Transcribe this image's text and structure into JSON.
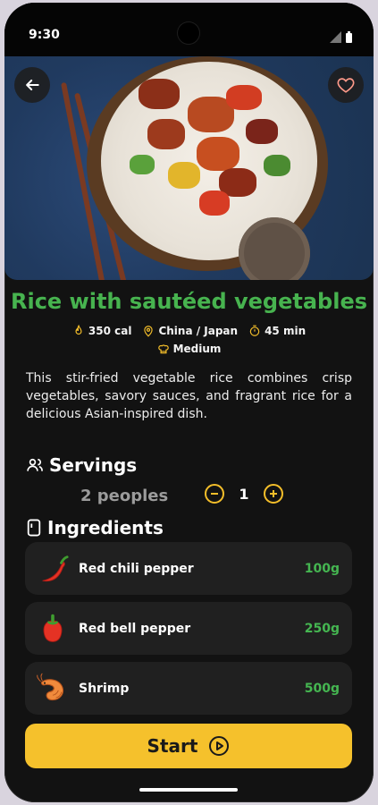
{
  "status": {
    "time": "9:30"
  },
  "recipe": {
    "title": "Rice with sautéed vegetables",
    "calories": "350 cal",
    "origin": "China / Japan",
    "duration": "45 min",
    "difficulty": "Medium",
    "description": "This stir-fried vegetable rice combines crisp vegetables, savory sauces, and fragrant rice for a delicious Asian-inspired dish."
  },
  "servings": {
    "title": "Servings",
    "label": "2 peoples",
    "value": "1"
  },
  "ingredients": {
    "title": "Ingredients",
    "items": [
      {
        "name": "Red chili pepper",
        "qty": "100g",
        "icon": "chili-pepper-icon"
      },
      {
        "name": "Red bell pepper",
        "qty": "250g",
        "icon": "bell-pepper-icon"
      },
      {
        "name": "Shrimp",
        "qty": "500g",
        "icon": "shrimp-icon"
      }
    ]
  },
  "actions": {
    "start_label": "Start"
  },
  "colors": {
    "accent": "#f5c12c",
    "title_green": "#47b34f",
    "qty_green": "#45b651",
    "background": "#121212",
    "card": "#202020"
  }
}
